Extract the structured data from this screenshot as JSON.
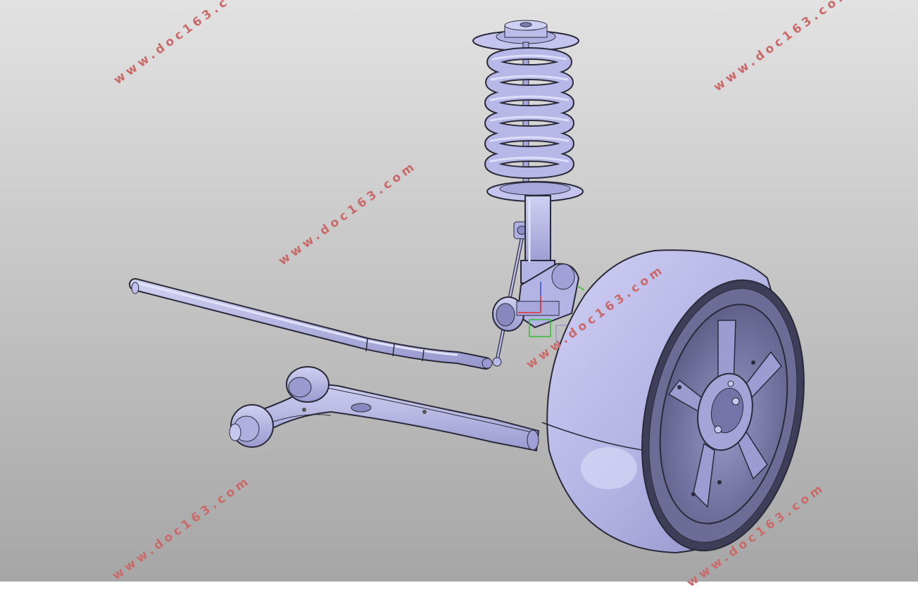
{
  "viewport": {
    "background_top": "#e0e0e0",
    "background_bottom": "#a7a7a7",
    "part_color": "#b8b8e6",
    "part_edge": "#2a2a3a"
  },
  "watermark": {
    "text": "www.doc163.com",
    "clipped_text": "www.doc163.c",
    "clipped_text_2": "www.doc163.com",
    "color": "#c96a6a"
  },
  "triad": {
    "x_color": "#e03030",
    "y_color": "#30c030",
    "z_color": "#3050e0"
  }
}
